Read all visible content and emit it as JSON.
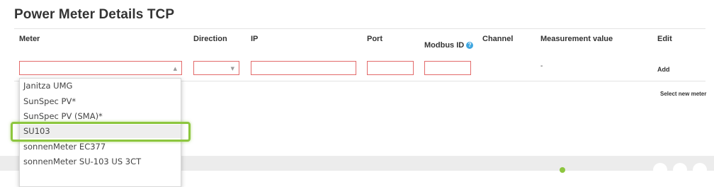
{
  "page_title": "Power Meter Details TCP",
  "table": {
    "headers": {
      "meter": "Meter",
      "direction": "Direction",
      "ip": "IP",
      "port": "Port",
      "modbus_id": "Modbus ID",
      "channel": "Channel",
      "measurement_value": "Measurement value",
      "edit": "Edit"
    },
    "row": {
      "meter_value": "",
      "direction_value": "",
      "ip_value": "",
      "port_value": "",
      "modbus_id_value": "",
      "measurement_value": "-",
      "add_label": "Add"
    },
    "select_new_meter_label": "Select new meter"
  },
  "dropdown": {
    "options": [
      "Janitza UMG",
      "SunSpec PV*",
      "SunSpec PV (SMA)*",
      "SU103",
      "sonnenMeter EC377",
      "sonnenMeter SU-103 US 3CT"
    ],
    "highlighted": "SU103"
  },
  "colors": {
    "error_border": "#e36a6a",
    "highlight": "#8dc63f",
    "help_icon": "#3fa6e0"
  }
}
